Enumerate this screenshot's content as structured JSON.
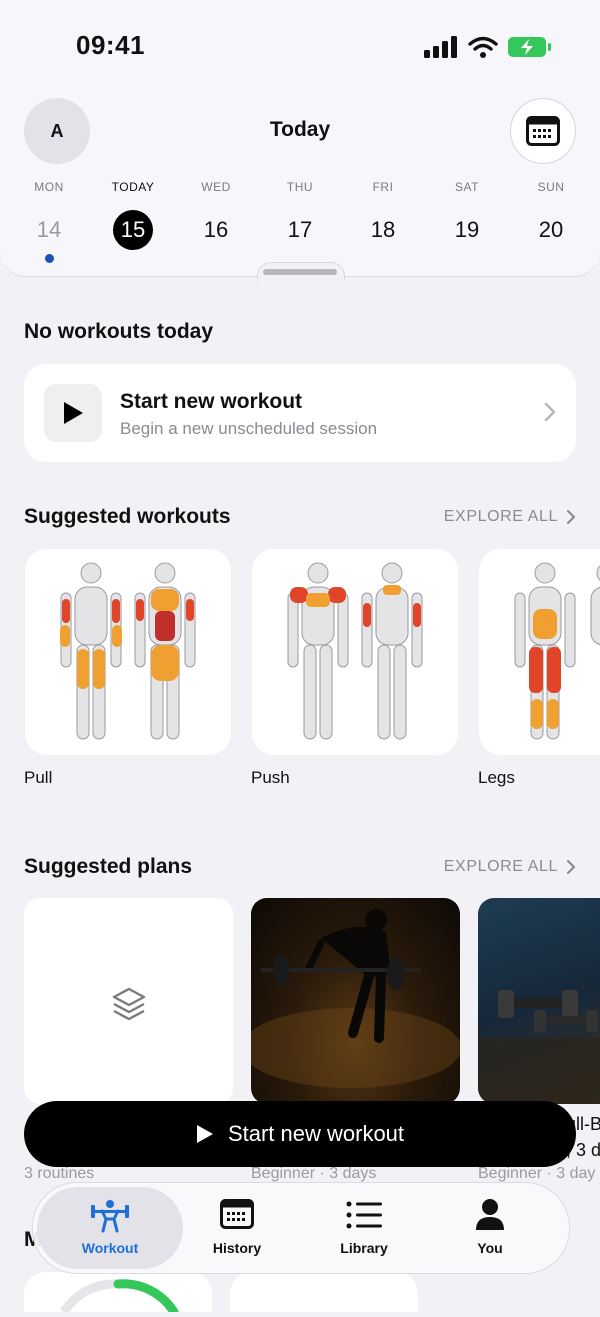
{
  "status_bar": {
    "time": "09:41"
  },
  "header": {
    "avatar_initial": "A",
    "title": "Today",
    "calendar_icon": "calendar-icon",
    "days": [
      {
        "name": "MON",
        "num": "14",
        "state": "past",
        "has_dot": true
      },
      {
        "name": "TODAY",
        "num": "15",
        "state": "selected"
      },
      {
        "name": "WED",
        "num": "16"
      },
      {
        "name": "THU",
        "num": "17"
      },
      {
        "name": "FRI",
        "num": "18"
      },
      {
        "name": "SAT",
        "num": "19"
      },
      {
        "name": "SUN",
        "num": "20"
      }
    ]
  },
  "today": {
    "heading": "No workouts today",
    "start_card": {
      "title": "Start new workout",
      "subtitle": "Begin a new unscheduled session"
    }
  },
  "suggested_workouts": {
    "heading": "Suggested workouts",
    "explore": "EXPLORE ALL",
    "items": [
      {
        "label": "Pull"
      },
      {
        "label": "Push"
      },
      {
        "label": "Legs"
      }
    ]
  },
  "suggested_plans": {
    "heading": "Suggested plans",
    "explore": "EXPLORE ALL",
    "items": [
      {
        "meta": "3 routines"
      },
      {
        "meta": "Beginner · 3 days"
      },
      {
        "title_partial": "ull-B",
        "meta_partial": ", 3 d",
        "meta": "Beginner · 3 day"
      }
    ]
  },
  "cta": {
    "label": "Start new workout"
  },
  "peek_heading_letter": "M",
  "tabbar": {
    "tabs": [
      {
        "label": "Workout",
        "icon": "dumbbell-person-icon",
        "active": true
      },
      {
        "label": "History",
        "icon": "calendar-icon"
      },
      {
        "label": "Library",
        "icon": "list-icon"
      },
      {
        "label": "You",
        "icon": "person-icon"
      }
    ]
  },
  "colors": {
    "accent": "#1f6fd8",
    "battery": "#34c759",
    "dot": "#1a52b8",
    "progress": "#34c759"
  }
}
